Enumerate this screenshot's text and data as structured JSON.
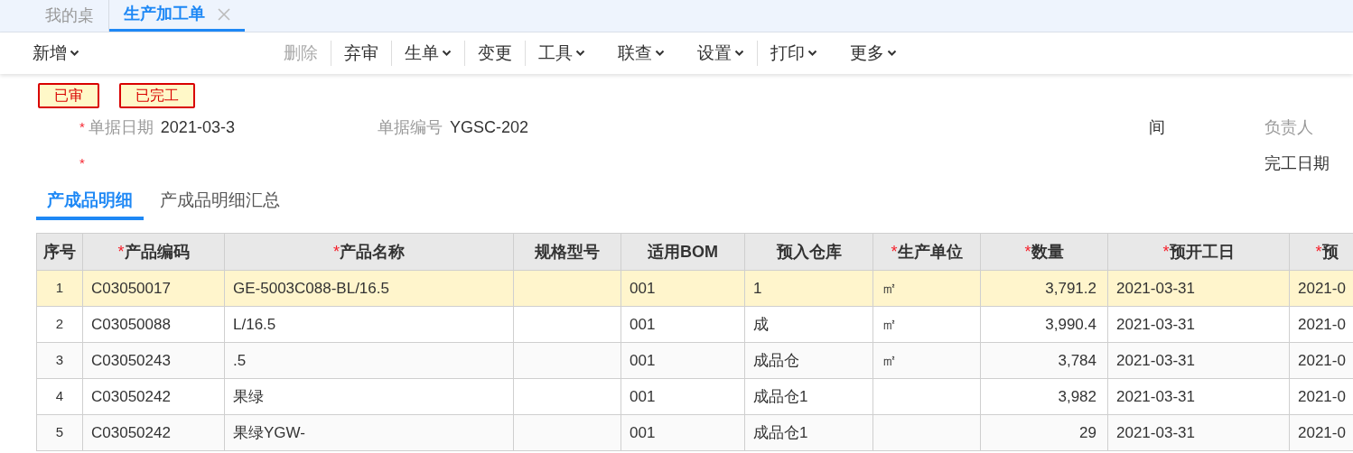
{
  "tabs": [
    {
      "label": "我的桌",
      "selected": false,
      "closable": false
    },
    {
      "label": "生产加工单",
      "selected": true,
      "closable": true
    }
  ],
  "toolbar": [
    {
      "label": "新增",
      "dropdown": true,
      "disabled": false,
      "separator_after": false
    },
    {
      "label": "删除",
      "dropdown": false,
      "disabled": true,
      "separator_after": true
    },
    {
      "label": "弃审",
      "dropdown": false,
      "disabled": false,
      "separator_after": true
    },
    {
      "label": "生单",
      "dropdown": true,
      "disabled": false,
      "separator_after": true
    },
    {
      "label": "变更",
      "dropdown": false,
      "disabled": false,
      "separator_after": true
    },
    {
      "label": "工具",
      "dropdown": true,
      "disabled": false,
      "separator_after": false
    },
    {
      "label": "联查",
      "dropdown": true,
      "disabled": false,
      "separator_after": false
    },
    {
      "label": "设置",
      "dropdown": true,
      "disabled": false,
      "separator_after": true
    },
    {
      "label": "打印",
      "dropdown": true,
      "disabled": false,
      "separator_after": false
    },
    {
      "label": "更多",
      "dropdown": true,
      "disabled": false,
      "separator_after": false
    }
  ],
  "status_badges": [
    "已审",
    "已完工"
  ],
  "form_rows": [
    [
      {
        "mark": "*",
        "label": "单据日期",
        "value": "2021-03-3",
        "muted": true
      },
      {
        "label": "单据编号",
        "value": "YGSC-202",
        "muted": true
      },
      {
        "label": "间",
        "muted": false
      },
      {
        "label": "负责人",
        "muted": true
      }
    ],
    [
      {
        "mark": "*"
      },
      null,
      null,
      {
        "label": "完工日期",
        "muted": false
      }
    ]
  ],
  "detail_tabs": [
    {
      "label": "产成品明细",
      "selected": true
    },
    {
      "label": "产成品明细汇总",
      "selected": false
    }
  ],
  "table": {
    "columns": [
      {
        "label": "序号"
      },
      {
        "mark": "*",
        "label": "产品编码"
      },
      {
        "mark": "*",
        "label": "产品名称"
      },
      {
        "label": "规格型号"
      },
      {
        "label": "适用BOM"
      },
      {
        "label": "预入仓库"
      },
      {
        "mark": "*",
        "label": "生产单位"
      },
      {
        "mark": "*",
        "label": "数量"
      },
      {
        "mark": "*",
        "label": "预开工日"
      },
      {
        "mark": "*",
        "label": "预"
      }
    ],
    "rows": [
      {
        "selected": true,
        "cells": [
          "1",
          "C03050017",
          "GE-5003C088-BL/16.5",
          "",
          "001",
          "1",
          "㎡",
          "3,791.2",
          "2021-03-31",
          "2021-0"
        ]
      },
      {
        "selected": false,
        "cells": [
          "2",
          "C03050088",
          "L/16.5",
          "",
          "001",
          "成",
          "㎡",
          "3,990.4",
          "2021-03-31",
          "2021-0"
        ]
      },
      {
        "selected": false,
        "cells": [
          "3",
          "C03050243",
          ".5",
          "",
          "001",
          "成品仓",
          "㎡",
          "3,784",
          "2021-03-31",
          "2021-0"
        ]
      },
      {
        "selected": false,
        "cells": [
          "4",
          "C03050242",
          "果绿",
          "",
          "001",
          "成品仓1",
          "",
          "3,982",
          "2021-03-31",
          "2021-0"
        ]
      },
      {
        "selected": false,
        "cells": [
          "5",
          "C03050242",
          "果绿YGW-",
          "",
          "001",
          "成品仓1",
          "",
          "29",
          "2021-03-31",
          "2021-0"
        ]
      }
    ]
  }
}
